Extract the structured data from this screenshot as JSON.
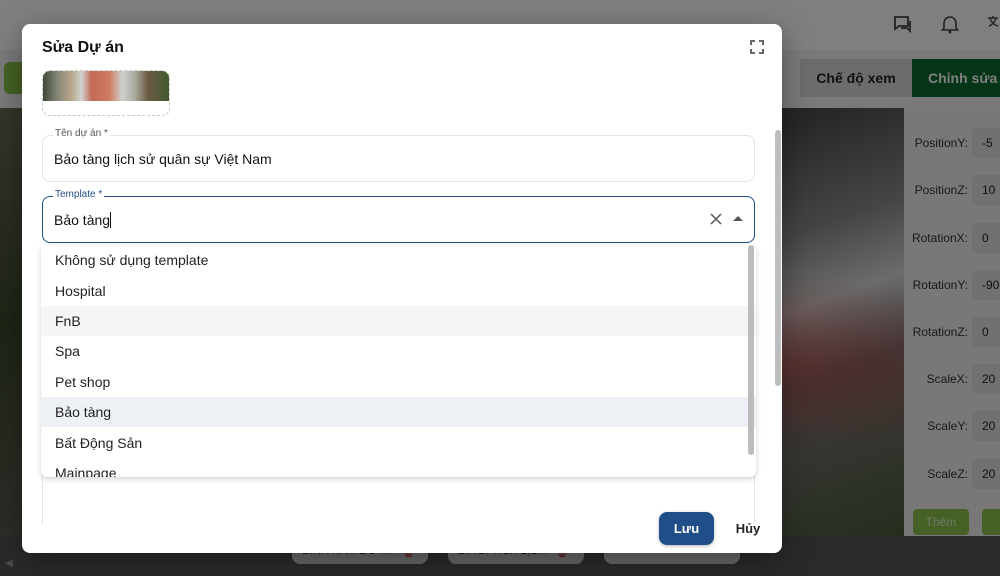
{
  "background": {
    "header_icons": [
      "chat-icon",
      "bell-icon",
      "translate-icon"
    ],
    "mode_tabs": {
      "view": "Chế độ xem",
      "edit": "Chỉnh sửa t"
    },
    "properties": [
      {
        "label": "PositionY:",
        "value": "-5"
      },
      {
        "label": "PositionZ:",
        "value": "10"
      },
      {
        "label": "RotationX:",
        "value": "0"
      },
      {
        "label": "RotationY:",
        "value": "-90"
      },
      {
        "label": "RotationZ:",
        "value": "0"
      },
      {
        "label": "ScaleX:",
        "value": "20"
      },
      {
        "label": "ScaleY:",
        "value": "20"
      },
      {
        "label": "ScaleZ:",
        "value": "20"
      }
    ],
    "add_button": "Thêm",
    "chips": [
      "ĐÌNH NAM ĐỒ T...",
      "BIA DI TÍCH LỊC..."
    ]
  },
  "modal": {
    "title": "Sửa Dự án",
    "fields": {
      "project_name": {
        "label": "Tên dự án *",
        "value": "Bảo tàng lịch sử quân sự Việt Nam"
      },
      "template": {
        "label": "Template *",
        "value": "Bảo tàng"
      }
    },
    "template_options": [
      "Không sử dụng template",
      "Hospital",
      "FnB",
      "Spa",
      "Pet shop",
      "Bảo tàng",
      "Bất Động Sản",
      "Mainpage"
    ],
    "selected_option": "Bảo tàng",
    "hovered_option": "FnB",
    "buttons": {
      "save": "Lưu",
      "cancel": "Hủy"
    }
  },
  "colors": {
    "primary": "#1f4e89",
    "edit_mode_green": "#0b6b2f",
    "add_green": "#8bc34a"
  }
}
